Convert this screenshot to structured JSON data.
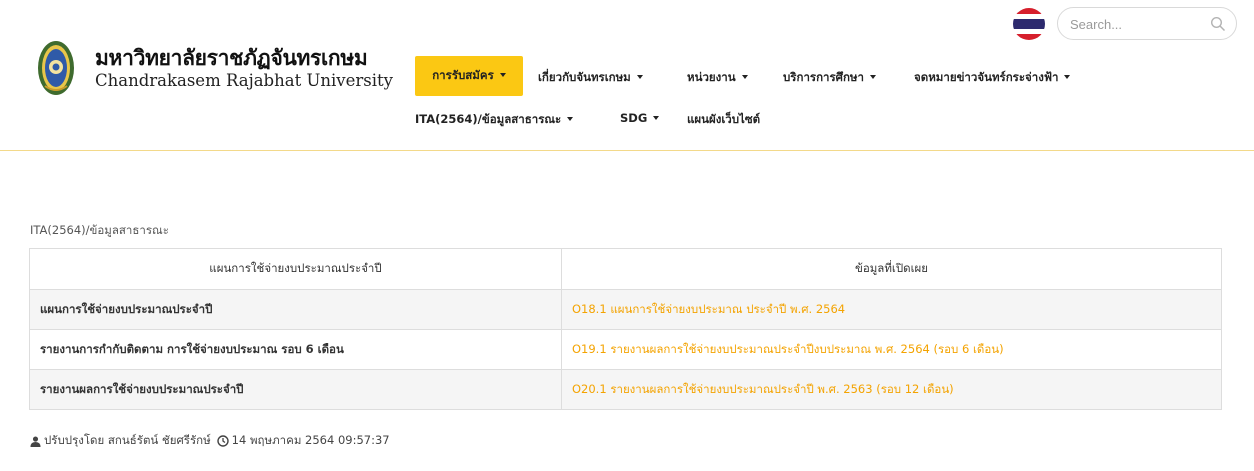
{
  "brand": {
    "name_th": "มหาวิทยาลัยราชภัฏจันทรเกษม",
    "name_en": "Chandrakasem Rajabhat University"
  },
  "search": {
    "placeholder": "Search..."
  },
  "nav": {
    "row1": [
      {
        "label": "การรับสมัคร",
        "active": true
      },
      {
        "label": "เกี่ยวกับจันทรเกษม"
      },
      {
        "label": "หน่วยงาน"
      },
      {
        "label": "บริการการศึกษา"
      },
      {
        "label": "จดหมายข่าวจันทร์กระจ่างฟ้า"
      }
    ],
    "row2": [
      {
        "label": "ITA(2564)/ข้อมูลสาธารณะ"
      },
      {
        "label": "SDG"
      },
      {
        "label": "แผนผังเว็บไซต์"
      }
    ]
  },
  "breadcrumb": "ITA(2564)/ข้อมูลสาธารณะ",
  "table": {
    "headers": [
      "แผนการใช้จ่ายงบประมาณประจำปี",
      "ข้อมูลที่เปิดเผย"
    ],
    "rows": [
      {
        "topic": "แผนการใช้จ่ายงบประมาณประจำปี",
        "link": "O18.1 แผนการใช้จ่ายงบประมาณ ประจำปี พ.ศ. 2564"
      },
      {
        "topic": "รายงานการกำกับติดตาม การใช้จ่ายงบประมาณ รอบ 6 เดือน",
        "link": "O19.1 รายงานผลการใช้จ่ายงบประมาณประจำปีงบประมาณ พ.ศ. 2564 (รอบ 6 เดือน)"
      },
      {
        "topic": "รายงานผลการใช้จ่ายงบประมาณประจำปี",
        "link": "O20.1 รายงานผลการใช้จ่ายงบประมาณประจำปี พ.ศ. 2563 (รอบ 12 เดือน)"
      }
    ]
  },
  "footer": {
    "updated_by": "ปรับปรุงโดย สกนธ์รัตน์ ชัยศรีรักษ์",
    "updated_at": "14 พฤษภาคม 2564 09:57:37"
  },
  "colors": {
    "accent": "#fbc813",
    "link": "#f4a300",
    "divider": "#f3d98a"
  },
  "icons": [
    "university-logo-icon",
    "thai-flag-icon",
    "search-icon",
    "user-icon",
    "clock-icon",
    "caret-down-icon"
  ]
}
